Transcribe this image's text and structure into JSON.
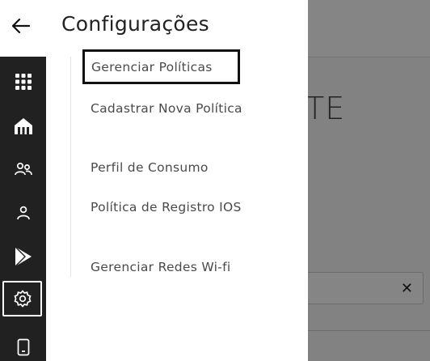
{
  "background": {
    "title_fragment": "TE",
    "clear_symbol": "✕"
  },
  "header": {
    "title": "Configurações",
    "back_icon": "arrow-left-icon"
  },
  "rail": {
    "items": [
      {
        "icon": "apps-grid-icon"
      },
      {
        "icon": "building-icon"
      },
      {
        "icon": "users-icon"
      },
      {
        "icon": "user-icon"
      },
      {
        "icon": "play-store-icon"
      },
      {
        "icon": "settings-gear-icon",
        "active": true
      },
      {
        "icon": "device-icon"
      }
    ]
  },
  "menu": {
    "items": [
      {
        "label": "Gerenciar Políticas",
        "selected": true
      },
      {
        "label": "Cadastrar Nova Política"
      },
      {
        "label": "Perfil de Consumo"
      },
      {
        "label": "Política de Registro IOS"
      },
      {
        "label": "Gerenciar Redes Wi-fi"
      }
    ]
  },
  "colors": {
    "rail_bg": "#212121",
    "overlay": "rgba(0,0,0,0.48)",
    "text": "#4a4a4a"
  }
}
